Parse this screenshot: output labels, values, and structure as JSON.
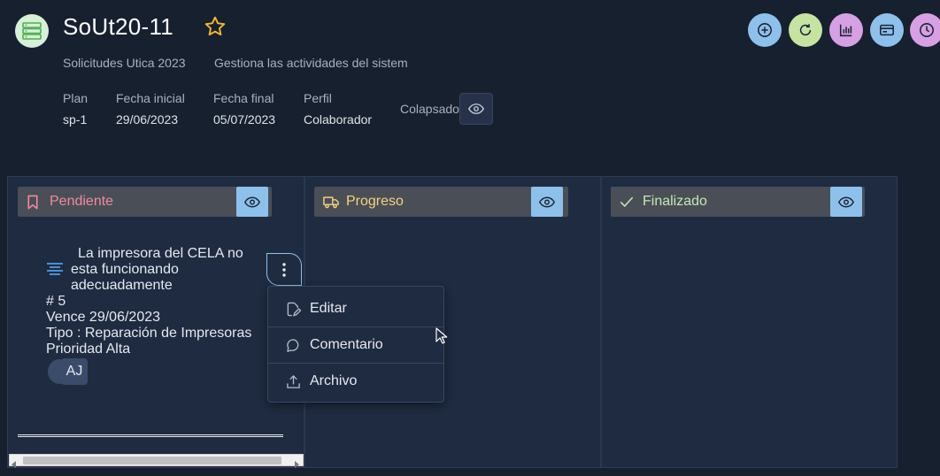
{
  "header": {
    "title": "SoUt20-11",
    "project": "Solicitudes Utica 2023",
    "description": "Gestiona las actividades del sistem",
    "meta": [
      {
        "label": "Plan",
        "value": "sp-1"
      },
      {
        "label": "Fecha inicial",
        "value": "29/06/2023"
      },
      {
        "label": "Fecha final",
        "value": "05/07/2023"
      },
      {
        "label": "Perfil",
        "value": "Colaborador"
      }
    ],
    "collapsed_label": "Colapsado"
  },
  "actions": [
    {
      "icon": "plus-circle-icon",
      "color": "#8ec0ec"
    },
    {
      "icon": "refresh-icon",
      "color": "#c7e3a2"
    },
    {
      "icon": "bar-chart-icon",
      "color": "#d7a0e4"
    },
    {
      "icon": "card-icon",
      "color": "#8ec0ec"
    },
    {
      "icon": "clock-icon",
      "color": "#d7a0e4"
    }
  ],
  "columns": [
    {
      "title": "Pendiente",
      "icon": "bookmark-icon",
      "color": "#f08aa0"
    },
    {
      "title": "Progreso",
      "icon": "truck-icon",
      "color": "#f3d27e"
    },
    {
      "title": "Finalizado",
      "icon": "check-icon",
      "color": "#c6e7b3"
    }
  ],
  "card": {
    "title_line1": "La impresora del CELA no",
    "title_line2": "esta funcionando",
    "title_line3": "adecuadamente",
    "number": "# 5",
    "due": "Vence 29/06/2023",
    "type": "Tipo : Reparación de Impresoras",
    "priority": "Prioridad Alta",
    "assignee_initials": "AJ"
  },
  "menu": {
    "items": [
      {
        "label": "Editar",
        "icon": "edit-file-icon"
      },
      {
        "label": "Comentario",
        "icon": "comment-icon"
      },
      {
        "label": "Archivo",
        "icon": "upload-icon"
      }
    ]
  }
}
